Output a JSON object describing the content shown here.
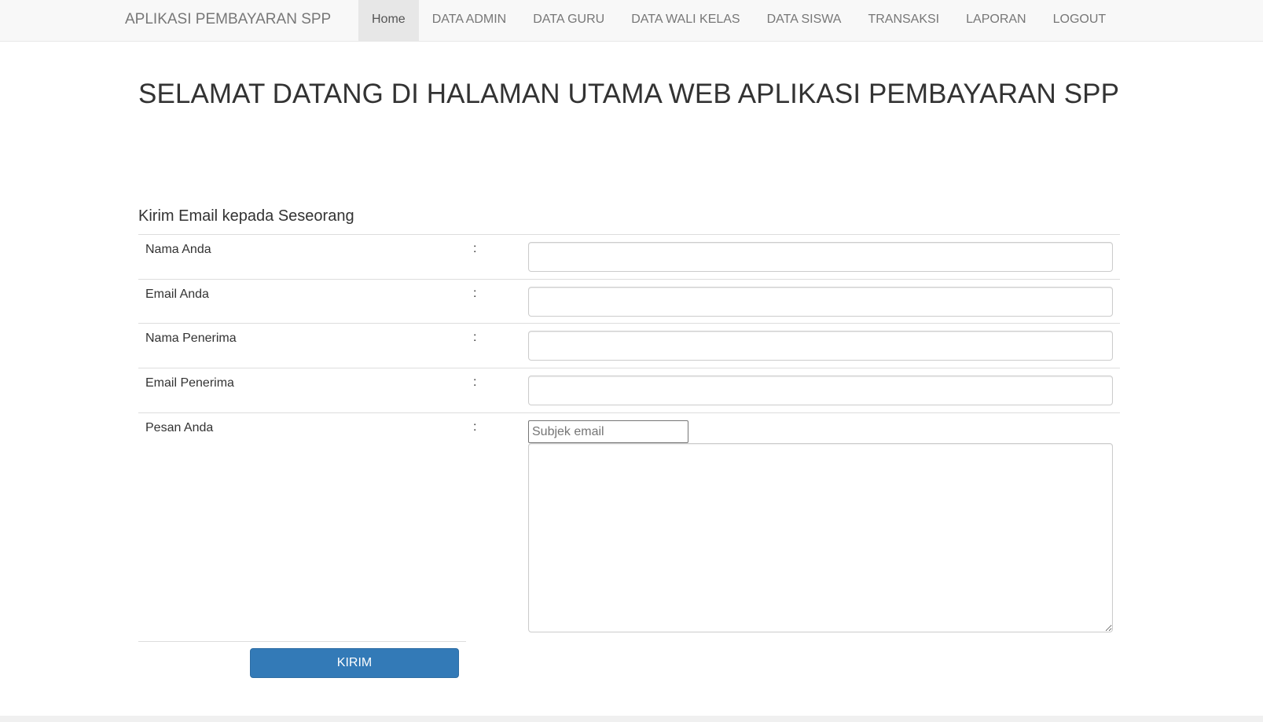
{
  "navbar": {
    "brand": "APLIKASI PEMBAYARAN SPP",
    "items": [
      {
        "label": "Home",
        "active": true
      },
      {
        "label": "DATA ADMIN",
        "active": false
      },
      {
        "label": "DATA GURU",
        "active": false
      },
      {
        "label": "DATA WALI KELAS",
        "active": false
      },
      {
        "label": "DATA SISWA",
        "active": false
      },
      {
        "label": "TRANSAKSI",
        "active": false
      },
      {
        "label": "LAPORAN",
        "active": false
      },
      {
        "label": "LOGOUT",
        "active": false
      }
    ]
  },
  "main": {
    "title": "SELAMAT DATANG DI HALAMAN UTAMA WEB APLIKASI PEMBAYARAN SPP"
  },
  "email_form": {
    "heading": "Kirim Email kepada Seseorang",
    "separator": ":",
    "fields": {
      "sender_name": {
        "label": "Nama Anda",
        "value": ""
      },
      "sender_email": {
        "label": "Email Anda",
        "value": ""
      },
      "recipient_name": {
        "label": "Nama Penerima",
        "value": ""
      },
      "recipient_email": {
        "label": "Email Penerima",
        "value": ""
      },
      "message": {
        "label": "Pesan Anda",
        "value": ""
      }
    },
    "subject": {
      "placeholder": "Subjek email",
      "value": ""
    },
    "submit_label": "KIRIM"
  },
  "colors": {
    "primary": "#337ab7",
    "navbar_bg": "#f8f8f8",
    "nav_active_bg": "#e7e7e7"
  }
}
